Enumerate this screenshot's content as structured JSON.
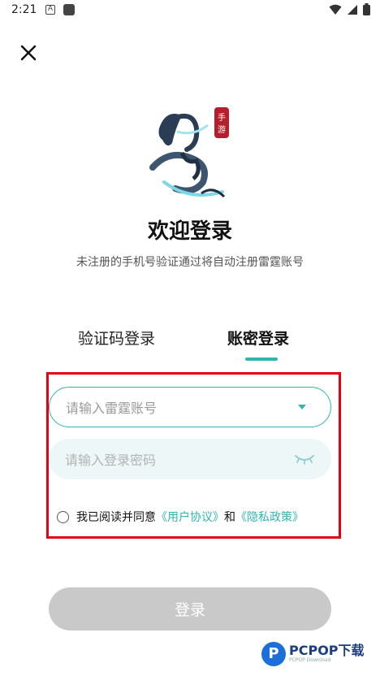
{
  "status_bar": {
    "time": "2:21",
    "a_icon": "A"
  },
  "header": {
    "close_icon": "close-icon"
  },
  "logo": {
    "side_text": "手游"
  },
  "title": "欢迎登录",
  "subtitle": "未注册的手机号验证通过将自动注册雷霆账号",
  "tabs": [
    {
      "label": "验证码登录",
      "active": false
    },
    {
      "label": "账密登录",
      "active": true
    }
  ],
  "form": {
    "account_placeholder": "请输入雷霆账号",
    "password_placeholder": "请输入登录密码"
  },
  "agreement": {
    "prefix": "我已阅读并同意",
    "user_agreement": "《用户协议》",
    "and": "和",
    "privacy_policy": "《隐私政策》"
  },
  "login_button": "登录",
  "watermark": {
    "logo_letter": "P",
    "name": "PCPOP下载",
    "sub": "PCPOP Download"
  },
  "colors": {
    "accent": "#2fb6b0",
    "highlight": "#e60012",
    "button_disabled": "#c9c9c9"
  }
}
